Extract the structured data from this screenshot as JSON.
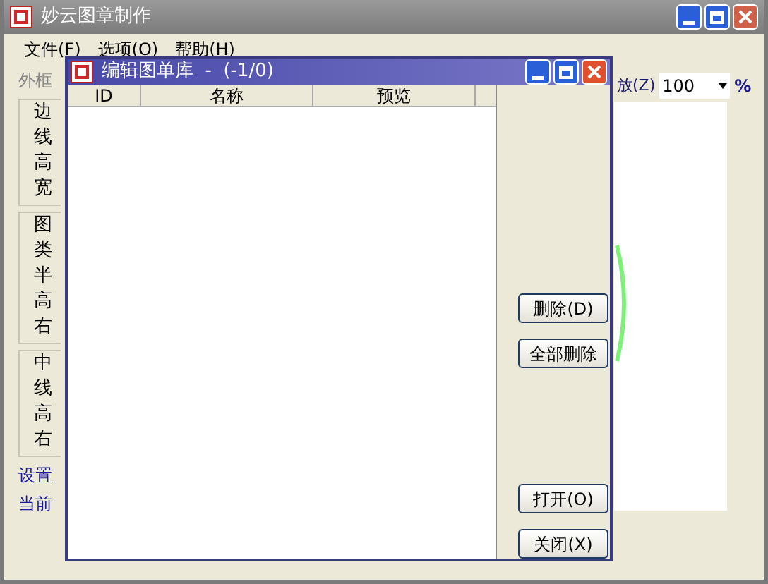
{
  "window": {
    "title": "妙云图章制作"
  },
  "menu": [
    {
      "label": "文件(F)"
    },
    {
      "label": "选项(O)"
    },
    {
      "label": "帮助(H)"
    }
  ],
  "tab": {
    "label": "外框"
  },
  "groups": [
    {
      "labels": [
        "边",
        "线",
        "高",
        "宽"
      ]
    },
    {
      "labels": [
        "图",
        "类",
        "半",
        "高",
        "右"
      ]
    },
    {
      "labels": [
        "中",
        "线",
        "高",
        "右"
      ]
    }
  ],
  "links": [
    "设置",
    "当前"
  ],
  "zoom": {
    "label": "放(Z)",
    "value": "100",
    "unit": "%"
  },
  "dialog": {
    "title": "编辑图单库  -  (-1/0)",
    "columns": [
      "ID",
      "名称",
      "预览"
    ],
    "top_buttons": [
      {
        "label": "删除(D)"
      },
      {
        "label": "全部删除"
      }
    ],
    "bottom_buttons": [
      {
        "label": "打开(O)"
      },
      {
        "label": "关闭(X)"
      }
    ]
  }
}
